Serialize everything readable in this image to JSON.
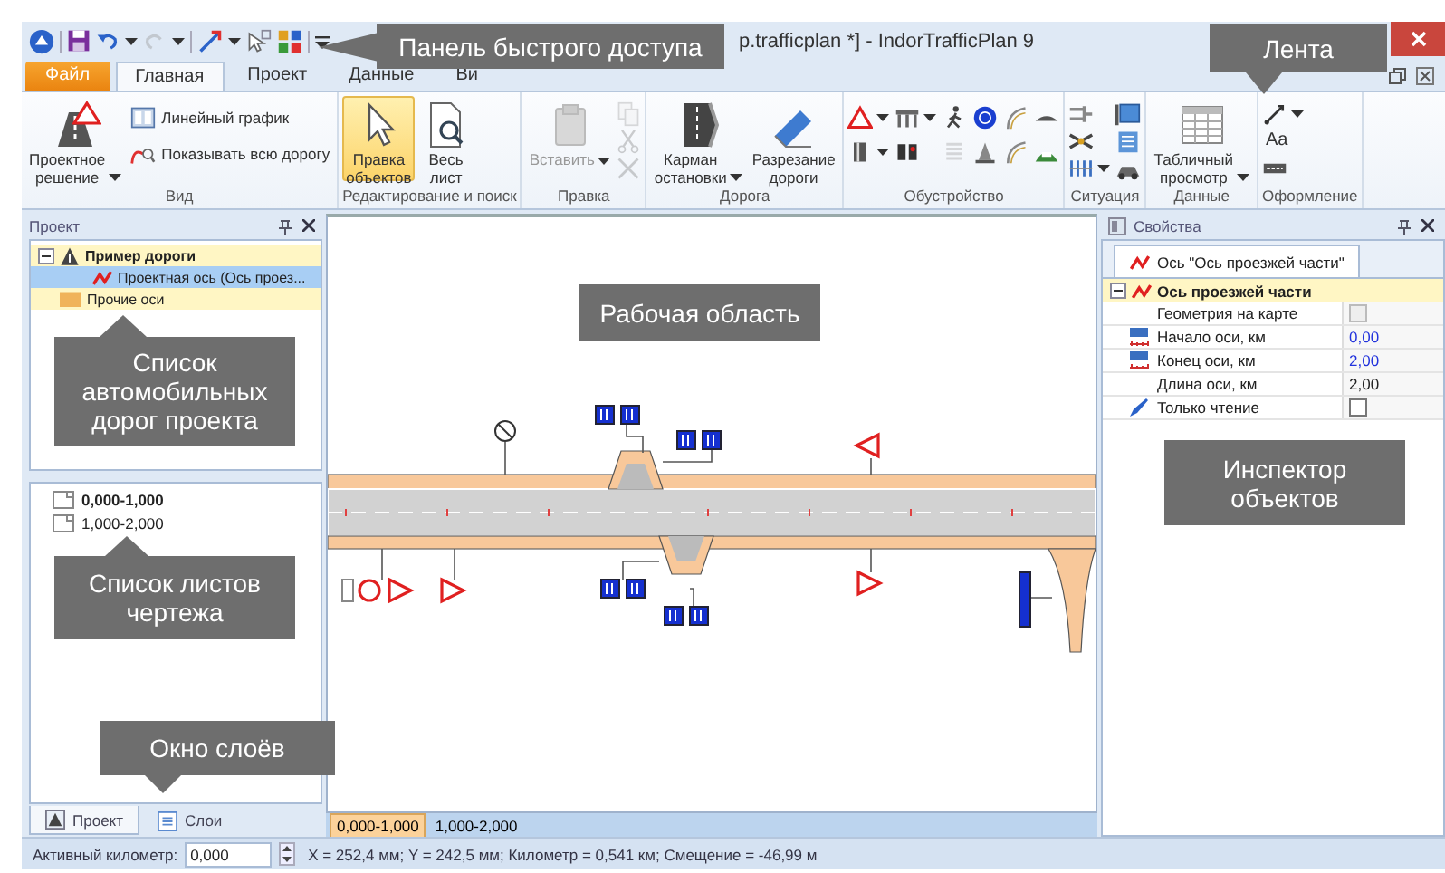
{
  "window": {
    "title": "p.trafficplan *] - IndorTrafficPlan 9"
  },
  "ribbon_tabs": [
    {
      "label": "Файл",
      "kind": "file",
      "selected": false
    },
    {
      "label": "Главная",
      "kind": "tab",
      "selected": true
    },
    {
      "label": "Проект",
      "kind": "tab",
      "selected": false
    },
    {
      "label": "Данные",
      "kind": "tab",
      "selected": false
    },
    {
      "label": "Ви",
      "kind": "tab",
      "selected": false
    }
  ],
  "ribbon_groups": [
    {
      "label": "Вид",
      "items": [
        {
          "kind": "large",
          "label": "Проектное решение",
          "dropdown": true,
          "selected": false,
          "disabled": false
        },
        {
          "kind": "small",
          "label": "Линейный график"
        },
        {
          "kind": "small",
          "label": "Показывать всю дорогу"
        }
      ]
    },
    {
      "label": "Редактирование и поиск",
      "items": [
        {
          "kind": "large",
          "label": "Правка объектов",
          "dropdown": false,
          "selected": true,
          "disabled": false
        },
        {
          "kind": "large",
          "label": "Весь лист",
          "dropdown": false,
          "selected": false,
          "disabled": false
        }
      ]
    },
    {
      "label": "Правка",
      "items": [
        {
          "kind": "large",
          "label": "Вставить",
          "dropdown": true,
          "selected": false,
          "disabled": true
        },
        {
          "kind": "icon",
          "dropdown": false,
          "disabled": true
        },
        {
          "kind": "icon",
          "dropdown": false,
          "disabled": true
        },
        {
          "kind": "icon",
          "dropdown": false,
          "disabled": true
        }
      ]
    },
    {
      "label": "Дорога",
      "items": [
        {
          "kind": "large",
          "label": "Карман остановки",
          "dropdown": true,
          "selected": false,
          "disabled": false
        },
        {
          "kind": "large",
          "label": "Разрезание дороги",
          "dropdown": false,
          "selected": false,
          "disabled": false
        }
      ]
    },
    {
      "label": "Обустройство",
      "items": [
        {
          "kind": "icon",
          "dropdown": true,
          "disabled": false
        },
        {
          "kind": "icon",
          "dropdown": true,
          "disabled": false
        },
        {
          "kind": "icon",
          "dropdown": true,
          "disabled": false
        },
        {
          "kind": "icon",
          "dropdown": false,
          "disabled": false
        },
        {
          "kind": "icon",
          "dropdown": false,
          "disabled": false
        },
        {
          "kind": "icon",
          "dropdown": false,
          "disabled": true
        },
        {
          "kind": "icon",
          "dropdown": false,
          "disabled": false
        },
        {
          "kind": "icon",
          "dropdown": false,
          "disabled": false
        },
        {
          "kind": "icon",
          "dropdown": false,
          "disabled": false
        },
        {
          "kind": "icon",
          "dropdown": false,
          "disabled": false
        },
        {
          "kind": "icon",
          "dropdown": false,
          "disabled": false
        },
        {
          "kind": "icon",
          "dropdown": false,
          "disabled": false
        }
      ]
    },
    {
      "label": "Ситуация",
      "items": [
        {
          "kind": "icon",
          "dropdown": false,
          "disabled": false
        },
        {
          "kind": "icon",
          "dropdown": false,
          "disabled": false
        },
        {
          "kind": "icon",
          "dropdown": true,
          "disabled": false
        },
        {
          "kind": "icon",
          "dropdown": false,
          "disabled": false
        },
        {
          "kind": "icon",
          "dropdown": false,
          "disabled": false
        },
        {
          "kind": "icon",
          "dropdown": false,
          "disabled": false
        }
      ]
    },
    {
      "label": "Данные",
      "items": [
        {
          "kind": "large",
          "label": "Табличный просмотр",
          "dropdown": true,
          "selected": false,
          "disabled": false
        }
      ]
    },
    {
      "label": "Оформление",
      "items": [
        {
          "kind": "icon",
          "dropdown": true,
          "disabled": false
        },
        {
          "kind": "glyph",
          "label": "Aa"
        },
        {
          "kind": "icon",
          "dropdown": false,
          "disabled": false
        }
      ]
    }
  ],
  "project_panel": {
    "title": "Проект",
    "tree": [
      {
        "label": "Пример дороги",
        "kind": "road",
        "selected": false,
        "expanded": true,
        "children": [
          {
            "label": "Проектная ось (Ось проез...",
            "kind": "axis",
            "selected": true
          }
        ]
      },
      {
        "label": "Прочие оси",
        "kind": "folder",
        "selected": false
      }
    ],
    "sheets": [
      {
        "label": "0,000-1,000",
        "active": true
      },
      {
        "label": "1,000-2,000",
        "active": false
      }
    ],
    "tabs": [
      {
        "label": "Проект",
        "selected": true
      },
      {
        "label": "Слои",
        "selected": false
      }
    ]
  },
  "workspace": {
    "sheet_tabs": [
      {
        "label": "0,000-1,000",
        "selected": true
      },
      {
        "label": "1,000-2,000",
        "selected": false
      }
    ]
  },
  "inspector": {
    "title": "Свойства",
    "tab": "Ось \"Ось проезжей части\"",
    "group": "Ось проезжей части",
    "expanded": true,
    "properties": [
      {
        "label": "Геометрия на карте",
        "kind": "flag",
        "checked": false,
        "disabled": true
      },
      {
        "label": "Начало оси, км",
        "kind": "measure",
        "value": "0,00",
        "edited": true
      },
      {
        "label": "Конец оси, км",
        "kind": "measure",
        "value": "2,00",
        "edited": true
      },
      {
        "label": "Длина оси, км",
        "kind": "value",
        "value": "2,00",
        "edited": false
      },
      {
        "label": "Только чтение",
        "kind": "option",
        "checked": false,
        "disabled": false
      }
    ]
  },
  "status_bar": {
    "label": "Активный километр:",
    "value": "0,000",
    "coordinates": "X = 252,4 мм; Y = 242,5 мм; Километр = 0,541 км; Смещение = -46,99 м"
  },
  "callouts": [
    {
      "text": "Панель быстрого доступа"
    },
    {
      "text": "Лента"
    },
    {
      "text": "Рабочая область"
    },
    {
      "text": "Список автомобильных дорог проекта"
    },
    {
      "text": "Список листов чертежа"
    },
    {
      "text": "Окно слоёв"
    },
    {
      "text": "Инспектор объектов"
    }
  ]
}
